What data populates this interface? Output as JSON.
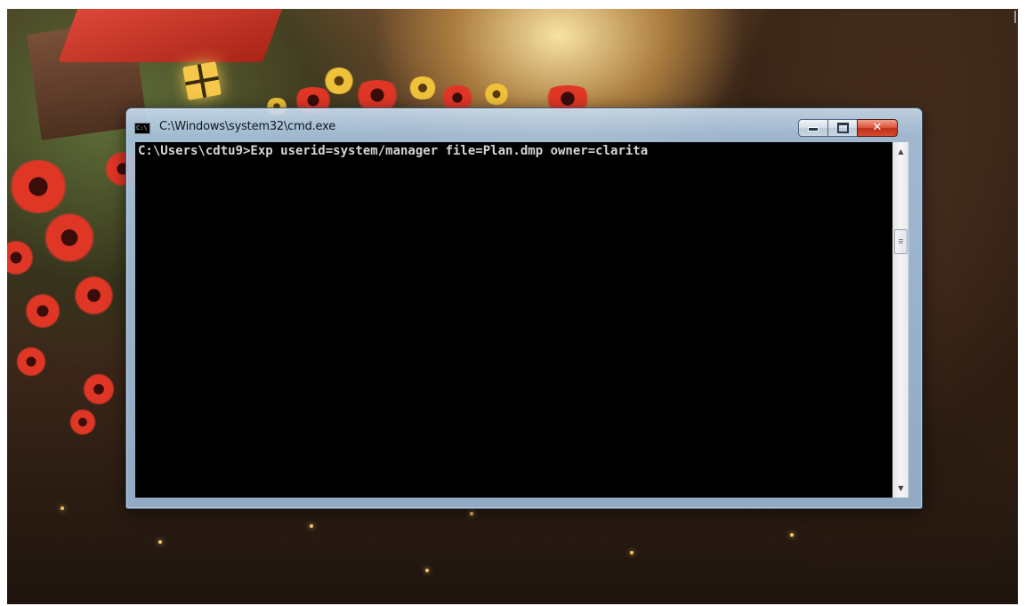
{
  "window": {
    "title": "C:\\Windows\\system32\\cmd.exe",
    "icon": "cmd-console-icon",
    "icon_text": "C:\\",
    "buttons": {
      "minimize_icon": "minimize-icon",
      "maximize_icon": "maximize-icon",
      "close_icon": "close-icon",
      "close_glyph": "✕"
    }
  },
  "console": {
    "prompt_line": "C:\\Users\\cdtu9>Exp userid=system/manager file=Plan.dmp owner=clarita",
    "background": "#000000",
    "foreground": "#d4d4d4"
  },
  "scrollbar": {
    "up_glyph": "▲",
    "down_glyph": "▼"
  },
  "colors": {
    "titlebar": "#b9cfe4",
    "close_button": "#c0301a"
  }
}
